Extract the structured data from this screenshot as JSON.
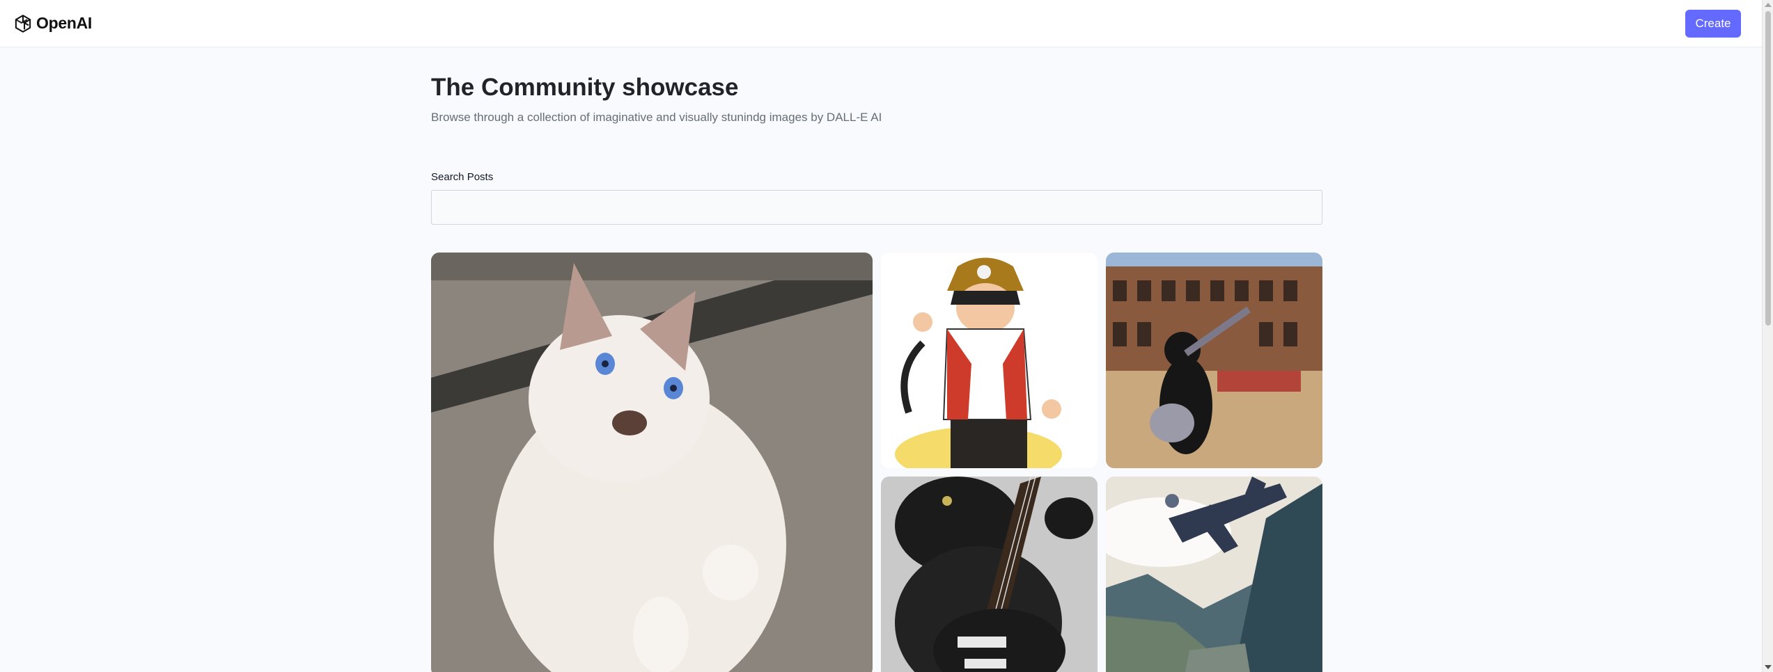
{
  "header": {
    "brand": "OpenAI",
    "create_label": "Create"
  },
  "main": {
    "title": "The Community showcase",
    "subtitle": "Browse through a collection of imaginative and visually stunindg images by DALL-E AI",
    "search": {
      "label": "Search Posts",
      "value": "",
      "placeholder": ""
    }
  },
  "gallery": {
    "items": [
      {
        "subject": "white siamese cat with blue eyes"
      },
      {
        "subject": "anime pirate boy with straw hat"
      },
      {
        "subject": "black cat playing guitar in the Colosseum"
      },
      {
        "subject": "black cat with electric guitar"
      },
      {
        "subject": "space shuttle over mountain valley"
      }
    ]
  },
  "colors": {
    "accent": "#6469ff",
    "background": "#f9fafe",
    "title": "#222328",
    "subtitle": "#666e75"
  }
}
